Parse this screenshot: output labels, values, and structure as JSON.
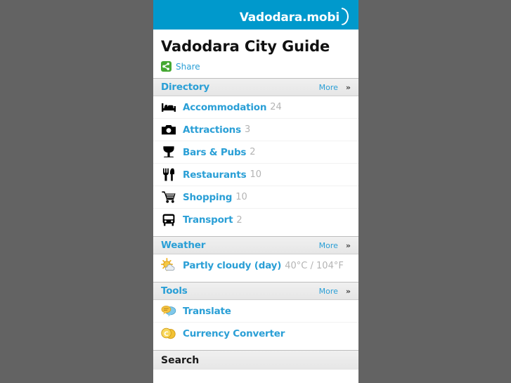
{
  "brand": {
    "name": "Vadodara.mobi",
    "bar_color": "#0099cc"
  },
  "title": {
    "heading": "Vadodara City Guide",
    "share_label": "Share"
  },
  "sections": [
    {
      "id": "directory",
      "header": "Directory",
      "more_label": "More",
      "more_chevron": "»",
      "items": [
        {
          "icon": "bed-icon",
          "label": "Accommodation",
          "count": "24"
        },
        {
          "icon": "camera-icon",
          "label": "Attractions",
          "count": "3"
        },
        {
          "icon": "cocktail-icon",
          "label": "Bars & Pubs",
          "count": "2"
        },
        {
          "icon": "cutlery-icon",
          "label": "Restaurants",
          "count": "10"
        },
        {
          "icon": "cart-icon",
          "label": "Shopping",
          "count": "10"
        },
        {
          "icon": "bus-icon",
          "label": "Transport",
          "count": "2"
        }
      ]
    },
    {
      "id": "weather",
      "header": "Weather",
      "more_label": "More",
      "more_chevron": "»",
      "items": [
        {
          "icon": "sun-cloud-icon",
          "label": "Partly cloudy (day)",
          "count": "40°C / 104°F"
        }
      ]
    },
    {
      "id": "tools",
      "header": "Tools",
      "more_label": "More",
      "more_chevron": "»",
      "items": [
        {
          "icon": "speech-bubbles-icon",
          "label": "Translate",
          "count": ""
        },
        {
          "icon": "currency-coins-icon",
          "label": "Currency Converter",
          "count": ""
        }
      ]
    }
  ],
  "search": {
    "header": "Search"
  },
  "colors": {
    "accent": "#2a9fd6",
    "brand_bar": "#0099cc",
    "page_background": "#636363",
    "count_grey": "#b4b4b4",
    "share_green": "#45a832"
  }
}
